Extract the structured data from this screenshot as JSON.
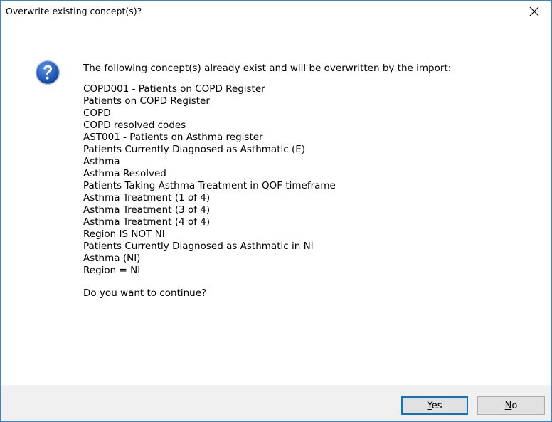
{
  "dialog": {
    "title": "Overwrite existing concept(s)?",
    "icon": "question-icon",
    "intro": "The following concept(s) already exist and will be overwritten by the import:",
    "concepts": [
      "COPD001 - Patients on COPD Register",
      "Patients on COPD Register",
      "COPD",
      "COPD resolved codes",
      "AST001 - Patients on Asthma register",
      "Patients Currently Diagnosed as Asthmatic (E)",
      "Asthma",
      "Asthma Resolved",
      "Patients Taking Asthma Treatment in QOF timeframe",
      "Asthma Treatment (1 of 4)",
      "Asthma Treatment (3 of 4)",
      "Asthma Treatment (4 of 4)",
      "Region IS NOT NI",
      "Patients Currently Diagnosed as Asthmatic in NI",
      "Asthma (NI)",
      "Region = NI"
    ],
    "prompt": "Do you want to continue?"
  },
  "buttons": {
    "yes": {
      "mnemonic": "Y",
      "rest": "es"
    },
    "no": {
      "mnemonic": "N",
      "rest": "o"
    }
  },
  "colors": {
    "accent": "#0078d7",
    "icon_blue": "#1c5bb5",
    "footer_bg": "#f0f0f0"
  }
}
